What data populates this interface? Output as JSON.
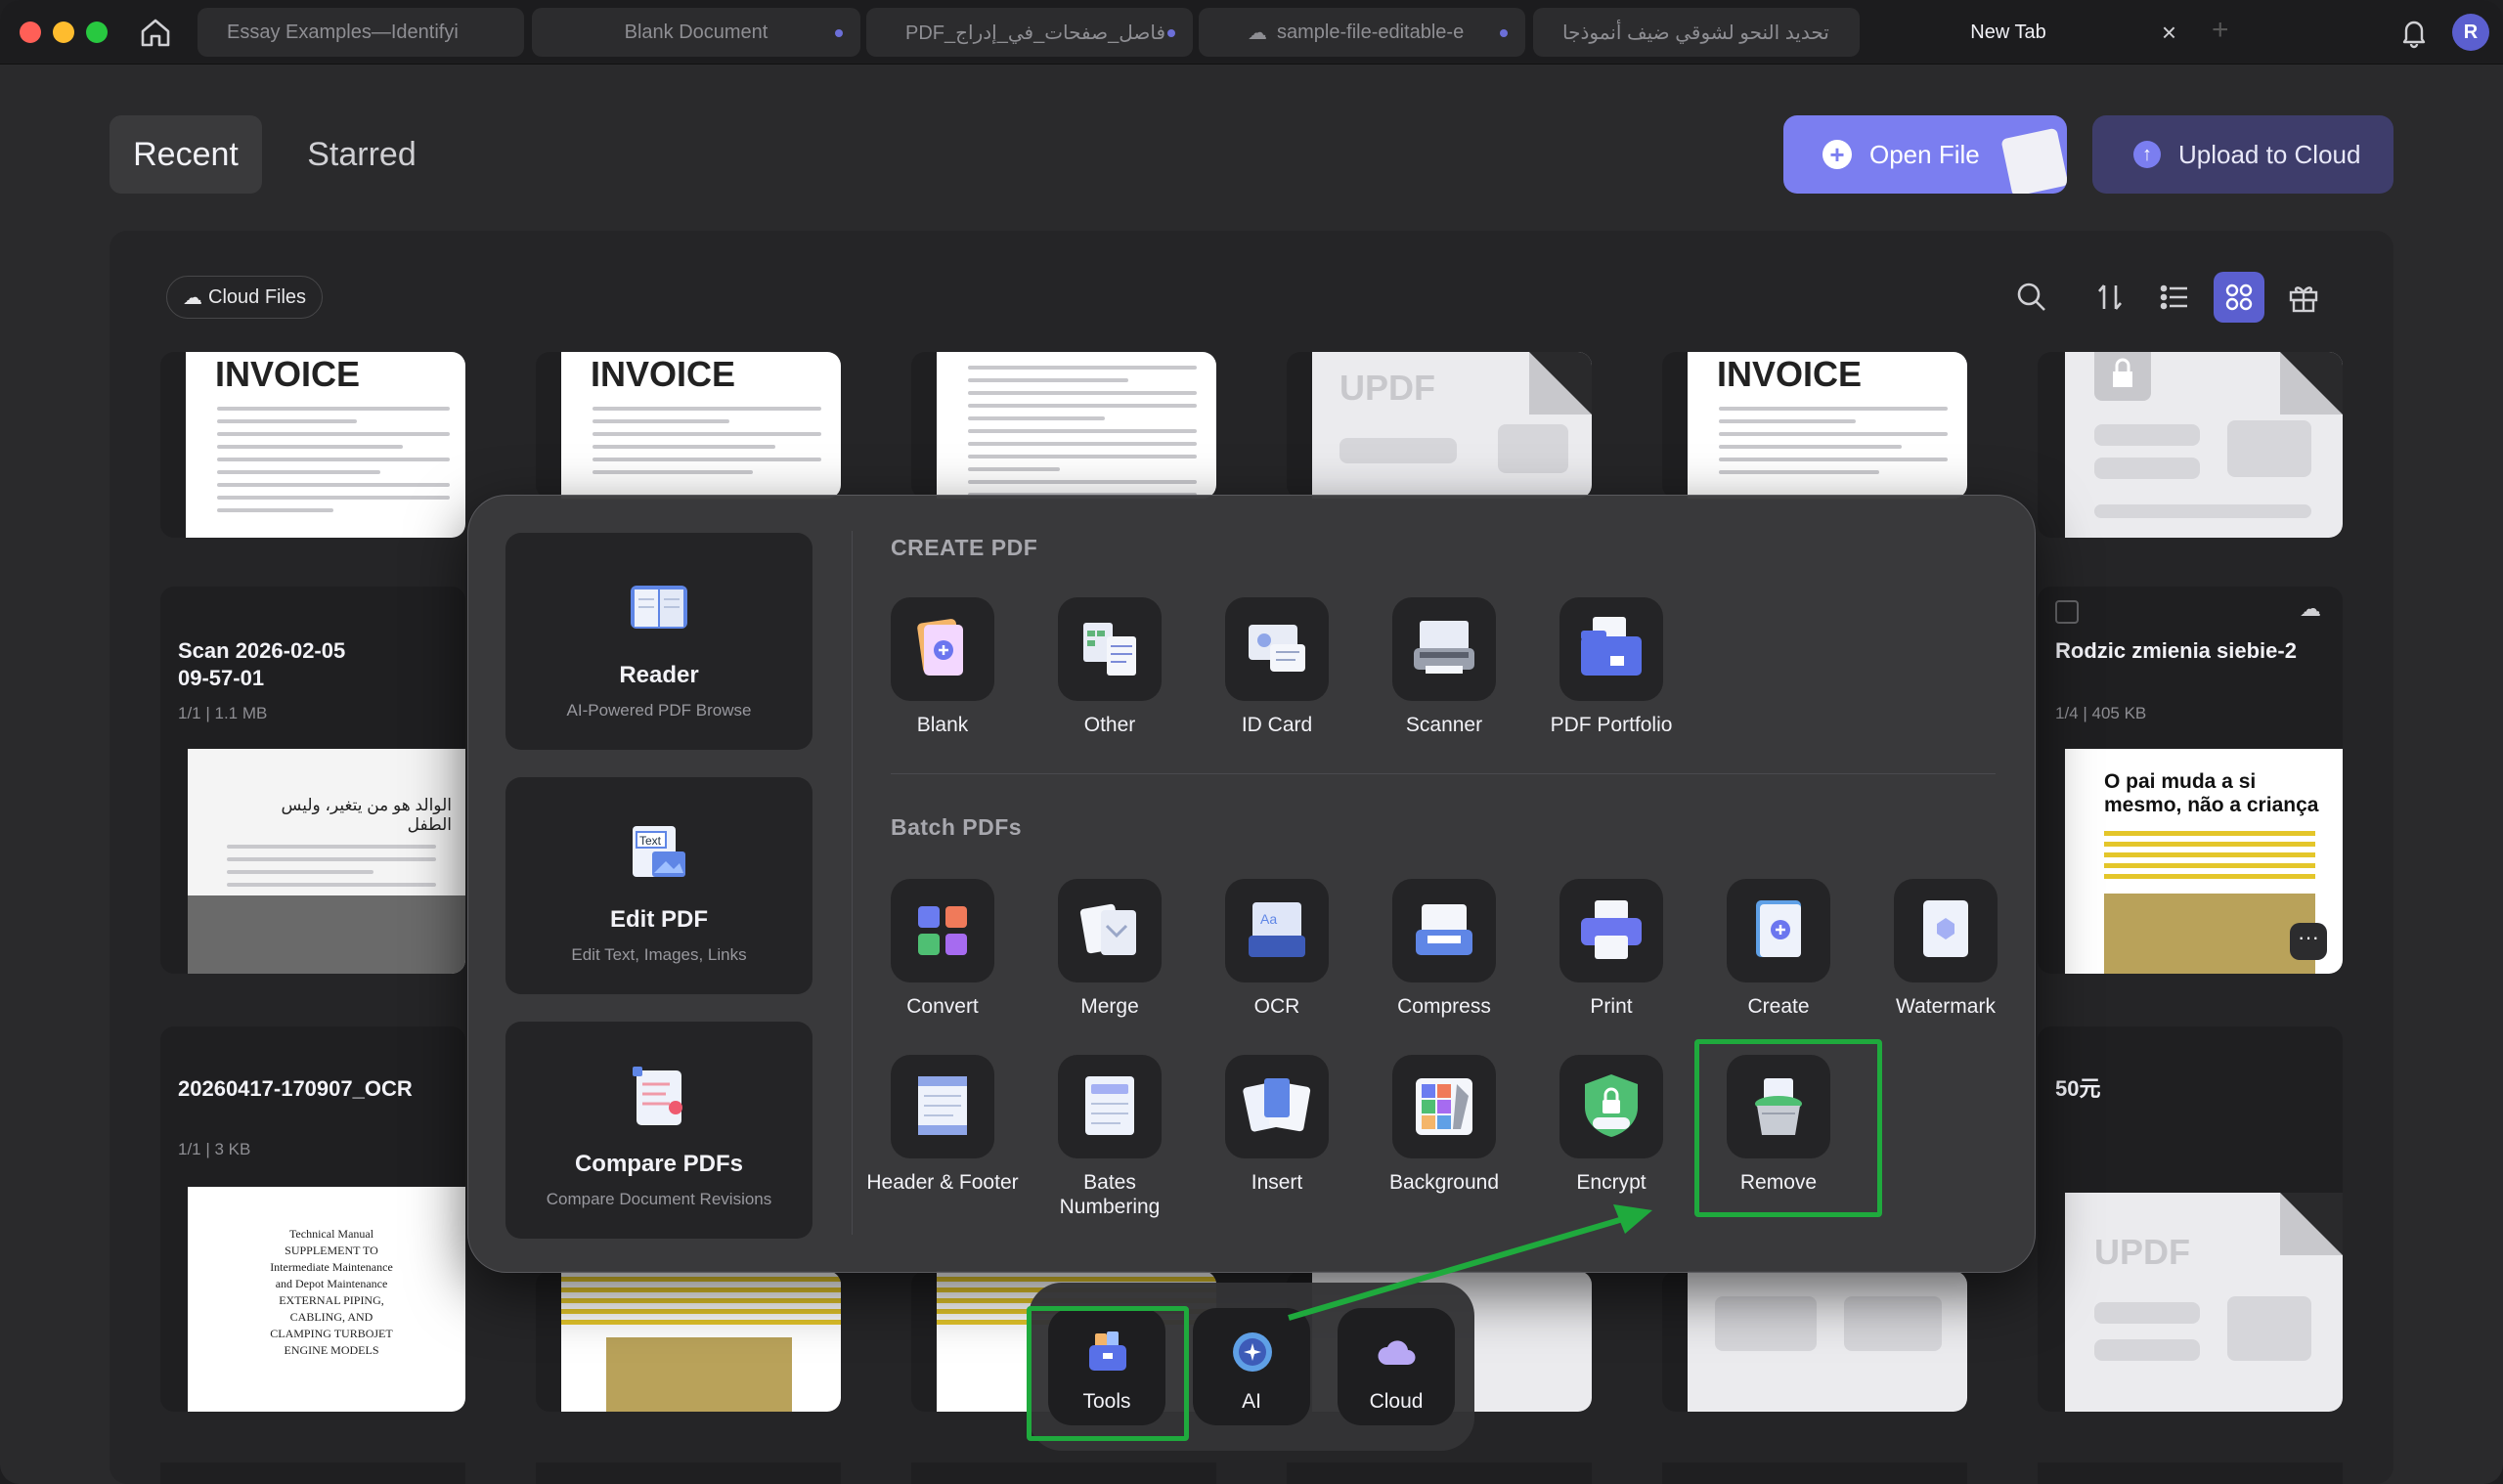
{
  "tabs": [
    {
      "label": "Essay Examples—Identifyi",
      "dot": false
    },
    {
      "label": "Blank Document",
      "dot": true
    },
    {
      "label": "PDF_فاصل_صفحات_في_إدراج",
      "dot": true
    },
    {
      "label": "sample-file-editable-e",
      "dot": true
    },
    {
      "label": "تحديد النحو لشوقي ضيف أنموذجا",
      "dot": false
    },
    {
      "label": "New Tab",
      "active": true
    }
  ],
  "avatar_initial": "R",
  "header": {
    "recent": "Recent",
    "starred": "Starred",
    "open_file": "Open File",
    "upload": "Upload to Cloud"
  },
  "toolbar": {
    "cloud_files": "Cloud Files"
  },
  "files": [
    {
      "thumb_heading": "INVOICE"
    },
    {
      "thumb_heading": "INVOICE"
    },
    {
      "thumb_heading": ""
    },
    {
      "thumb_heading": "UPDF"
    },
    {
      "thumb_heading": "INVOICE"
    },
    {
      "thumb_heading": ""
    },
    {
      "title": "Scan 2026-02-05 09-57-01",
      "meta": "1/1  |  1.1 MB",
      "thumb_text": "الوالد هو من يتغير، وليس الطفل"
    },
    {
      "title": "Rodzic zmienia siebie-2",
      "meta": "1/4  |  405 KB",
      "thumb_text": "O pai muda a si mesmo, não a criança"
    },
    {
      "title": "20260417-170907_OCR",
      "meta": "1/1  |  3 KB",
      "thumb_text": "Technical Manual SUPPLEMENT TO Intermediate Maintenance and Depot Maintenance EXTERNAL PIPING, CABLING, AND CLAMPING TURBOJET ENGINE MODELS"
    },
    {
      "title": "50元",
      "meta": "",
      "thumb_heading": "UPDF"
    }
  ],
  "popup": {
    "left_buttons": [
      {
        "title": "Reader",
        "sub": "AI-Powered PDF Browse",
        "icon": "book-icon"
      },
      {
        "title": "Edit PDF",
        "sub": "Edit Text, Images, Links",
        "icon": "edit-text-icon"
      },
      {
        "title": "Compare PDFs",
        "sub": "Compare Document Revisions",
        "icon": "compare-icon"
      }
    ],
    "create_label": "CREATE PDF",
    "create_items": [
      {
        "label": "Blank",
        "icon": "blank-icon"
      },
      {
        "label": "Other",
        "icon": "other-icon"
      },
      {
        "label": "ID Card",
        "icon": "id-card-icon"
      },
      {
        "label": "Scanner",
        "icon": "scanner-icon"
      },
      {
        "label": "PDF Portfolio",
        "icon": "portfolio-icon"
      }
    ],
    "batch_label": "Batch PDFs",
    "batch_row1": [
      {
        "label": "Convert",
        "icon": "convert-icon"
      },
      {
        "label": "Merge",
        "icon": "merge-icon"
      },
      {
        "label": "OCR",
        "icon": "ocr-icon"
      },
      {
        "label": "Compress",
        "icon": "compress-icon"
      },
      {
        "label": "Print",
        "icon": "print-icon"
      },
      {
        "label": "Create",
        "icon": "create-icon"
      },
      {
        "label": "Watermark",
        "icon": "watermark-icon"
      }
    ],
    "batch_row2": [
      {
        "label": "Header & Footer",
        "icon": "header-footer-icon"
      },
      {
        "label": "Bates Numbering",
        "icon": "bates-icon"
      },
      {
        "label": "Insert",
        "icon": "insert-icon"
      },
      {
        "label": "Background",
        "icon": "background-icon"
      },
      {
        "label": "Encrypt",
        "icon": "encrypt-icon"
      },
      {
        "label": "Remove",
        "icon": "remove-icon"
      }
    ]
  },
  "dock": [
    {
      "label": "Tools",
      "icon": "tools-icon"
    },
    {
      "label": "AI",
      "icon": "ai-icon"
    },
    {
      "label": "Cloud",
      "icon": "cloud-icon"
    }
  ],
  "colors": {
    "accent": "#7b7ef0",
    "highlight": "#1faa3d"
  }
}
